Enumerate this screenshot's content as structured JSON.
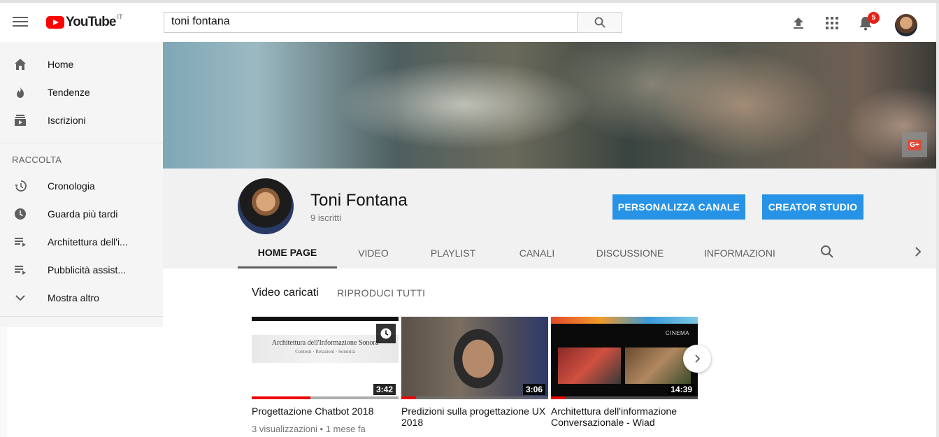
{
  "masthead": {
    "logo_text": "YouTube",
    "country_code": "IT",
    "search_value": "toni fontana",
    "notification_count": "5"
  },
  "sidebar": {
    "main_items": [
      {
        "label": "Home",
        "icon": "home-icon"
      },
      {
        "label": "Tendenze",
        "icon": "trending-icon"
      },
      {
        "label": "Iscrizioni",
        "icon": "subscriptions-icon"
      }
    ],
    "library_heading": "RACCOLTA",
    "library_items": [
      {
        "label": "Cronologia",
        "icon": "history-icon"
      },
      {
        "label": "Guarda più tardi",
        "icon": "watch-later-icon"
      },
      {
        "label": "Architettura dell'i...",
        "icon": "playlist-icon"
      },
      {
        "label": "Pubblicità assist...",
        "icon": "playlist-icon"
      },
      {
        "label": "Mostra altro",
        "icon": "chevron-down-icon"
      }
    ]
  },
  "channel": {
    "name": "Toni Fontana",
    "subscribers": "9 iscritti",
    "customize_label": "PERSONALIZZA CANALE",
    "studio_label": "CREATOR STUDIO",
    "gplus_label": "G+"
  },
  "tabs": [
    {
      "label": "HOME PAGE",
      "active": true
    },
    {
      "label": "VIDEO",
      "active": false
    },
    {
      "label": "PLAYLIST",
      "active": false
    },
    {
      "label": "CANALI",
      "active": false
    },
    {
      "label": "DISCUSSIONE",
      "active": false
    },
    {
      "label": "INFORMAZIONI",
      "active": false
    }
  ],
  "section": {
    "title": "Video caricati",
    "play_all": "RIPRODUCI TUTTI"
  },
  "videos": [
    {
      "title": "Progettazione Chatbot 2018",
      "duration": "3:42",
      "meta": "3 visualizzazioni • 1 mese fa",
      "thumb_line1": "Architettura dell'Informazione Sonora",
      "thumb_line2": "Contesti · Relazioni · Sonorità",
      "progress": 0.4
    },
    {
      "title": "Predizioni sulla progettazione UX 2018",
      "duration": "3:06",
      "progress": 0.1
    },
    {
      "title": "Architettura dell'informazione Conversazionale - Wiad",
      "duration": "14:39",
      "thumb_label": "CINEMA",
      "progress": 0.1
    }
  ],
  "colors": {
    "accent_blue": "#2793e6",
    "youtube_red": "#ff0000",
    "badge_red": "#e62117"
  }
}
